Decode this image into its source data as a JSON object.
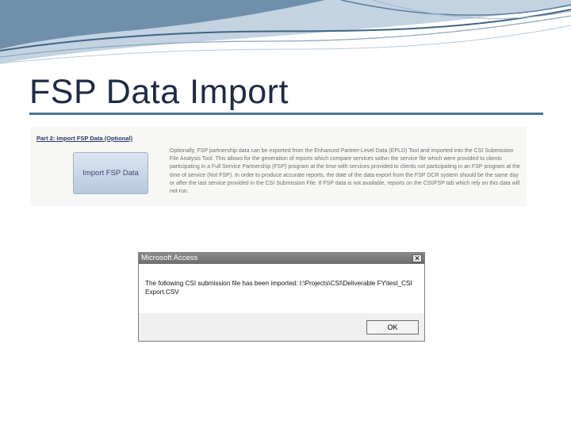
{
  "slide": {
    "title": "FSP Data Import"
  },
  "panel": {
    "header": "Part 2: Import FSP Data (Optional)",
    "button_label": "Import FSP Data",
    "description": "Optionally, FSP partnership data can be exported from the Enhanced Partner-Level Data (EPLD) Tool and imported into the CSI Submission File Analysis Tool. This allows for the generation of reports which compare services within the service file which were provided to clients participating in a Full Service Partnership (FSP) program at the time with services provided to clients not participating in an FSP program at the time of service (Not FSP). In order to produce accurate reports, the date of the data export from the FSP DCR system should be the same day or after the last service provided in the CSI Submission File. If FSP data is not available, reports on the CSI/FSP tab which rely on this data will not run."
  },
  "dialog": {
    "title": "Microsoft Access",
    "close_glyph": "✕",
    "message": "The following CSI submission file has been imported: I:\\Projects\\CSI\\Deliverable FY\\test_CSI Export.CSV",
    "ok_label": "OK"
  },
  "colors": {
    "title_text": "#1f2a44",
    "title_rule": "#4a7595",
    "wave_dark": "#4a6f8e",
    "wave_light": "#a9bfd4"
  }
}
